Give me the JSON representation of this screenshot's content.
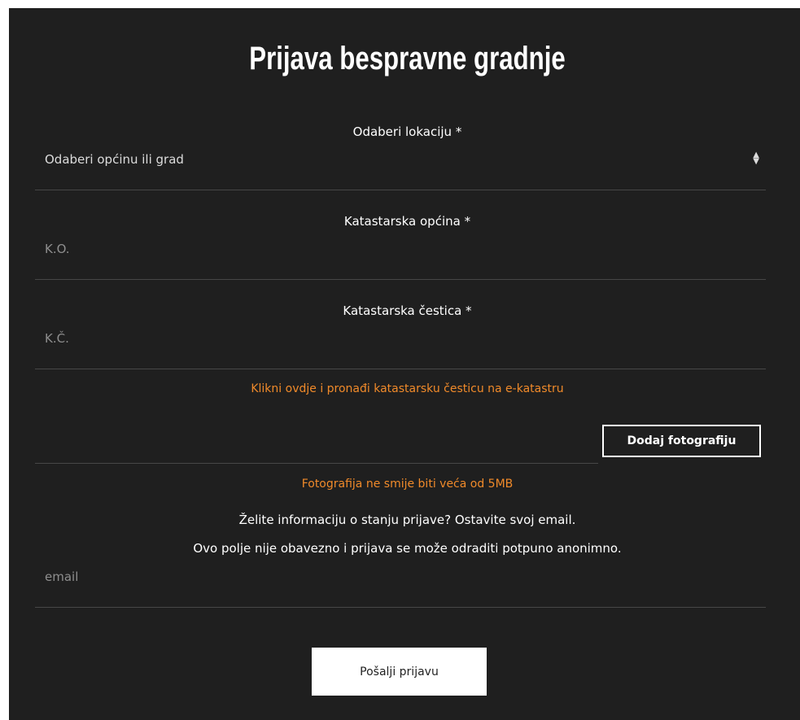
{
  "form": {
    "title": "Prijava bespravne gradnje",
    "location_label": "Odaberi lokaciju *",
    "location_select_value": "Odaberi općinu ili grad",
    "ko_label": "Katastarska općina *",
    "ko_placeholder": "K.O.",
    "kc_label": "Katastarska čestica *",
    "kc_placeholder": "K.Č.",
    "ekatastar_link": "Klikni ovdje i pronađi katastarsku česticu na e-katastru",
    "add_photo_button": "Dodaj fotografiju",
    "photo_limit_note": "Fotografija ne smije biti veća od 5MB",
    "email_info_line1": "Želite informaciju o stanju prijave? Ostavite svoj email.",
    "email_info_line2": "Ovo polje nije obavezno i prijava se može odraditi potpuno anonimno.",
    "email_placeholder": "email",
    "submit_button": "Pošalji prijavu"
  },
  "colors": {
    "background": "#1f1f1f",
    "accent": "#f08a2a",
    "text": "#ffffff"
  },
  "icons": {
    "select_arrows": "up-down-caret-icon"
  }
}
